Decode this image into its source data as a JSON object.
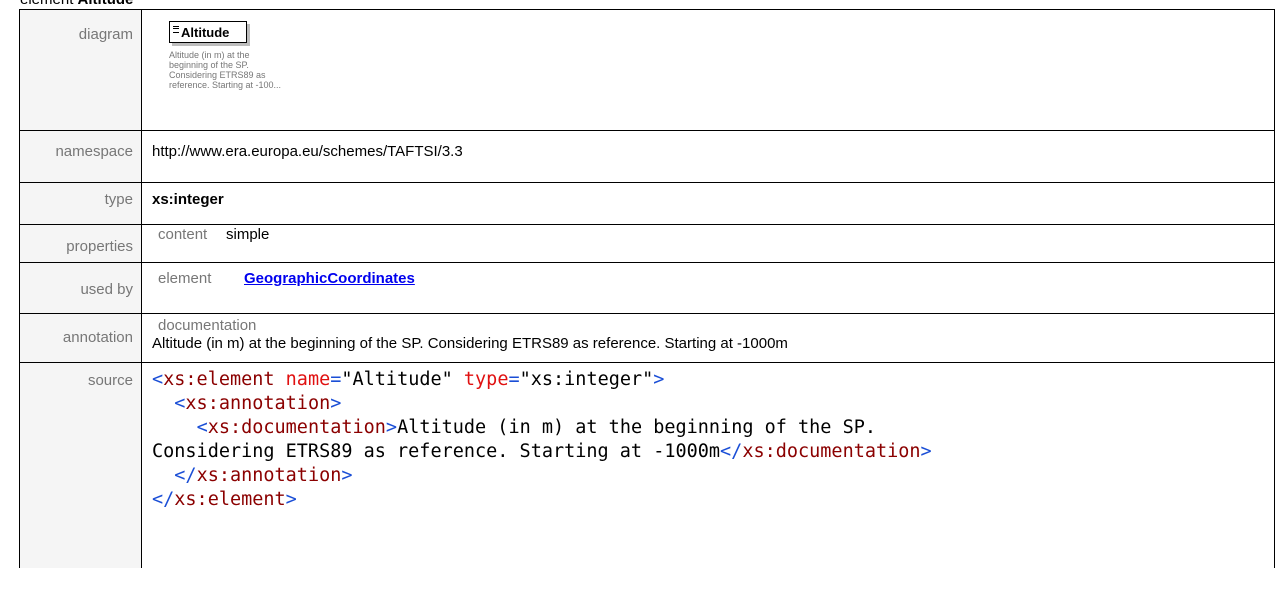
{
  "heading": {
    "prefix": "element",
    "name": "Altitude"
  },
  "labels": {
    "diagram": "diagram",
    "namespace": "namespace",
    "type": "type",
    "properties": "properties",
    "used_by": "used by",
    "annotation": "annotation",
    "source": "source"
  },
  "diagram": {
    "element_name": "Altitude",
    "doc_snippet": [
      "Altitude (in m) at the",
      "beginning of the SP.",
      "Considering ETRS89 as",
      "reference. Starting at -100..."
    ]
  },
  "namespace": "http://www.era.europa.eu/schemes/TAFTSI/3.3",
  "type": "xs:integer",
  "properties": {
    "key": "content",
    "value": "simple"
  },
  "used_by": {
    "key": "element",
    "link": "GeographicCoordinates"
  },
  "annotation": {
    "label": "documentation",
    "text": "Altitude (in m) at the beginning of the SP. Considering ETRS89 as reference. Starting at -1000m"
  },
  "source": {
    "line1": {
      "open": "<",
      "tag": "xs:element",
      "attr1": "name",
      "eq": "=",
      "q": "\"",
      "val1": "Altitude",
      "attr2": "type",
      "val2": "xs:integer",
      "close": ">"
    },
    "line2": {
      "open": "<",
      "tag": "xs:annotation",
      "close": ">"
    },
    "line3": {
      "open": "<",
      "tag": "xs:documentation",
      "close": ">",
      "text": "Altitude (in m) at the beginning of the SP."
    },
    "line4": {
      "text": "Considering ETRS89 as reference. Starting at -1000m",
      "open": "</",
      "tag": "xs:documentation",
      "close": ">"
    },
    "line5": {
      "open": "</",
      "tag": "xs:annotation",
      "close": ">"
    },
    "line6": {
      "open": "</",
      "tag": "xs:element",
      "close": ">"
    }
  },
  "colors": {
    "tag": "#8b0000",
    "bracket": "#1a4ed6",
    "attr": "#e01010",
    "link": "#0000ee",
    "label": "#777777"
  }
}
